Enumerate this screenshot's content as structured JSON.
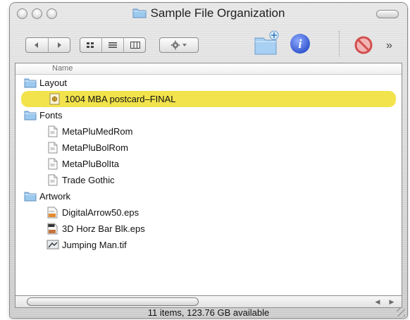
{
  "window": {
    "title": "Sample File Organization",
    "status_text": "11 items, 123.76 GB available"
  },
  "toolbar": {
    "icons": [
      "back-icon",
      "forward-icon",
      "icon-view-icon",
      "list-view-icon",
      "column-view-icon",
      "action-gear-icon",
      "new-folder-icon",
      "get-info-icon",
      "stop-icon",
      "overflow-chevron-icon"
    ]
  },
  "list": {
    "column_header": "Name",
    "rows": [
      {
        "label": "Layout",
        "level": 0,
        "kind": "folder"
      },
      {
        "label": "1004 MBA postcard–FINAL",
        "level": 1,
        "kind": "document",
        "selected": true
      },
      {
        "label": "Fonts",
        "level": 0,
        "kind": "folder"
      },
      {
        "label": "MetaPluMedRom",
        "level": 1,
        "kind": "font"
      },
      {
        "label": "MetaPluBolRom",
        "level": 1,
        "kind": "font"
      },
      {
        "label": "MetaPluBolIta",
        "level": 1,
        "kind": "font"
      },
      {
        "label": "Trade Gothic",
        "level": 1,
        "kind": "font"
      },
      {
        "label": "Artwork",
        "level": 0,
        "kind": "folder"
      },
      {
        "label": "DigitalArrow50.eps",
        "level": 1,
        "kind": "eps"
      },
      {
        "label": "3D Horz Bar Blk.eps",
        "level": 1,
        "kind": "eps"
      },
      {
        "label": "Jumping Man.tif",
        "level": 1,
        "kind": "tif"
      }
    ]
  },
  "colors": {
    "selection": "#f2e34c",
    "folder": "#8fc0ea",
    "info": "#3c63d6",
    "stop": "#e05a5a"
  }
}
